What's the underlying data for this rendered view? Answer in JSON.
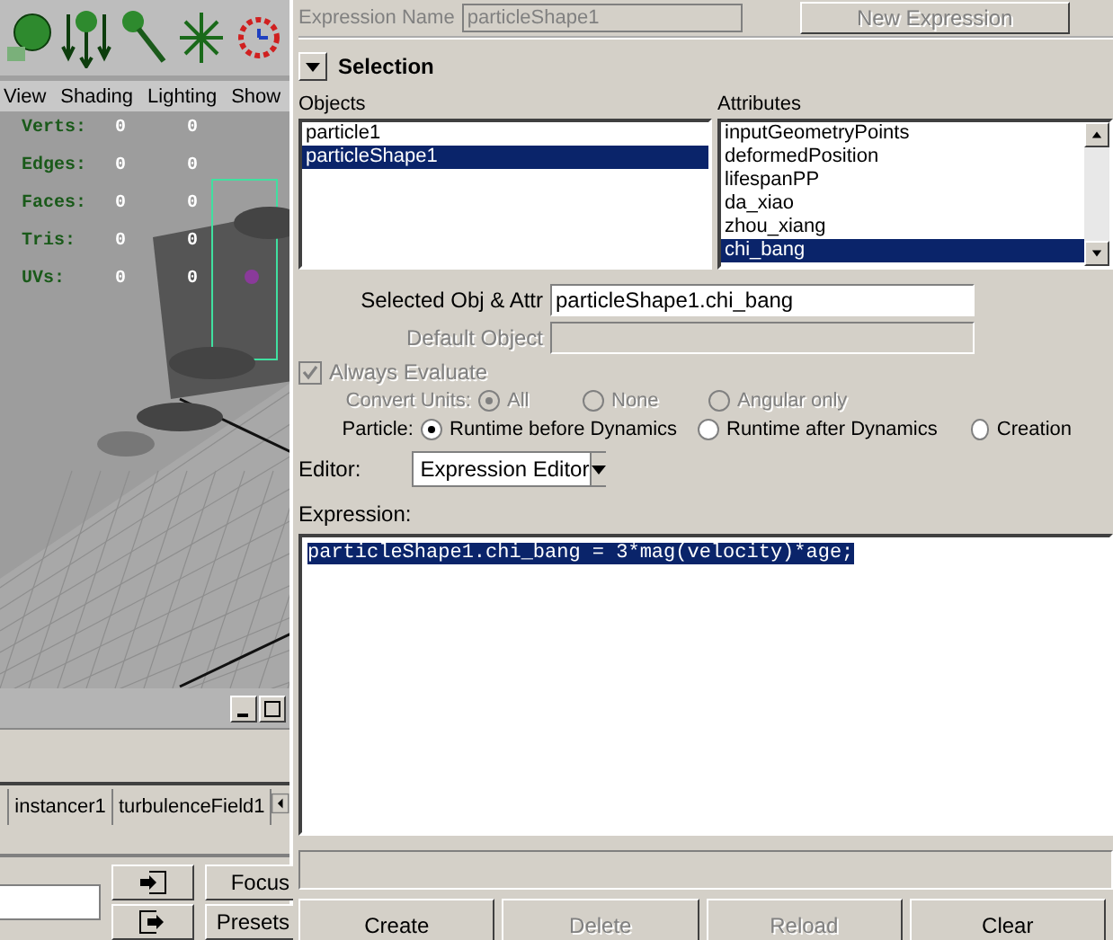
{
  "viewport": {
    "menu": [
      "View",
      "Shading",
      "Lighting",
      "Show"
    ],
    "stats": [
      {
        "label": "Verts:",
        "values": [
          "0",
          "0"
        ]
      },
      {
        "label": "Edges:",
        "values": [
          "0",
          "0"
        ]
      },
      {
        "label": "Faces:",
        "values": [
          "0",
          "0"
        ]
      },
      {
        "label": "Tris:",
        "values": [
          "0",
          "0"
        ]
      },
      {
        "label": "UVs:",
        "values": [
          "0",
          "0"
        ]
      }
    ]
  },
  "bottom_panel": {
    "tabs": [
      {
        "label": "instancer1",
        "selected": false
      },
      {
        "label": "turbulenceField1",
        "selected": false
      }
    ],
    "buttons": [
      "Focus",
      "Presets"
    ]
  },
  "expression_editor": {
    "name_label": "Expression Name",
    "name_value": "particleShape1",
    "new_button": {
      "label": "New Expression",
      "disabled": true
    },
    "section": {
      "title": "Selection",
      "expanded": true
    },
    "objects": {
      "label": "Objects",
      "items": [
        {
          "label": "particle1",
          "selected": false
        },
        {
          "label": "particleShape1",
          "selected": true
        }
      ]
    },
    "attributes": {
      "label": "Attributes",
      "items": [
        {
          "label": "inputGeometryPoints",
          "selected": false
        },
        {
          "label": "deformedPosition",
          "selected": false
        },
        {
          "label": "lifespanPP",
          "selected": false
        },
        {
          "label": "da_xiao",
          "selected": false
        },
        {
          "label": "zhou_xiang",
          "selected": false
        },
        {
          "label": "chi_bang",
          "selected": true
        }
      ]
    },
    "selected_obj_attr": {
      "label": "Selected Obj & Attr",
      "value": "particleShape1.chi_bang"
    },
    "default_object": {
      "label": "Default Object",
      "disabled": true
    },
    "always_evaluate": {
      "label": "Always Evaluate",
      "checked": true,
      "disabled": true
    },
    "convert_units": {
      "label": "Convert Units:",
      "disabled": true,
      "options": [
        {
          "label": "All",
          "selected": true
        },
        {
          "label": "None",
          "selected": false
        },
        {
          "label": "Angular only",
          "selected": false
        }
      ]
    },
    "particle": {
      "label": "Particle:",
      "disabled": false,
      "options": [
        {
          "label": "Runtime before Dynamics",
          "selected": true
        },
        {
          "label": "Runtime after Dynamics",
          "selected": false
        },
        {
          "label": "Creation",
          "selected": false
        }
      ]
    },
    "editor": {
      "label": "Editor:",
      "value": "Expression Editor"
    },
    "expression": {
      "label": "Expression:",
      "value": "particleShape1.chi_bang = 3*mag(velocity)*age;"
    },
    "buttons": [
      {
        "label": "Create",
        "disabled": false
      },
      {
        "label": "Delete",
        "disabled": true
      },
      {
        "label": "Reload",
        "disabled": true
      },
      {
        "label": "Clear",
        "disabled": false
      }
    ]
  }
}
